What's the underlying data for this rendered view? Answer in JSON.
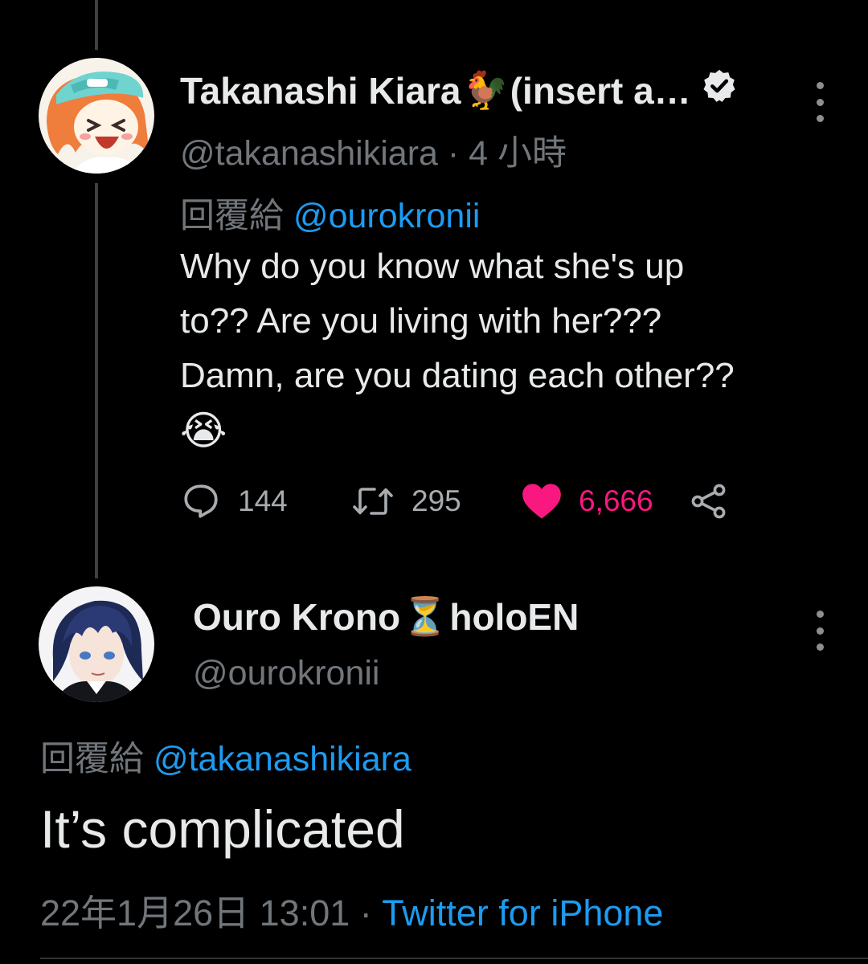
{
  "reply_tweet": {
    "author_name": "Takanashi Kiara",
    "author_name_emoji": "🐓",
    "author_name_suffix": "(insert a…",
    "handle": "@takanashikiara",
    "time_separator": "·",
    "time": "4 小時",
    "reply_label": "回覆給",
    "reply_to": "@ourokronii",
    "text_lines": [
      "Why do you know what she's up",
      "to?? Are you living with her???",
      "Damn, are you dating each other??"
    ],
    "text_emoji": "😭",
    "replies": "144",
    "retweets": "295",
    "likes": "6,666",
    "verified": true
  },
  "main_tweet": {
    "author_name": "Ouro Krono",
    "author_name_emoji": "⏳",
    "author_name_suffix": "holoEN",
    "handle": "@ourokronii",
    "reply_label": "回覆給",
    "reply_to": "@takanashikiara",
    "text": "It’s complicated",
    "date": "22年1月26日 13:01",
    "meta_separator": "·",
    "source": "Twitter for iPhone"
  },
  "colors": {
    "background": "#000000",
    "text": "#e7e9ea",
    "secondary": "#71767b",
    "link": "#1d9bf0",
    "like": "#f91880"
  },
  "icons": {
    "more": "more-vertical-icon",
    "reply": "reply-bubble-icon",
    "retweet": "retweet-icon",
    "like": "heart-icon",
    "share": "share-icon",
    "verified": "verified-badge-icon"
  }
}
